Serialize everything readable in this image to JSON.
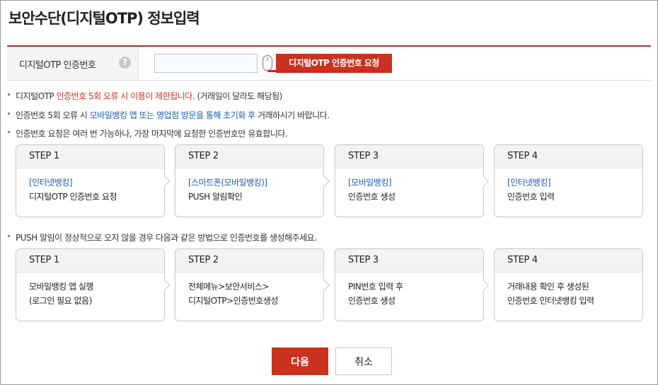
{
  "page": {
    "title": "보안수단(디지털OTP) 정보입력"
  },
  "form": {
    "label": "디지털OTP 인증번호",
    "help_icon": "question-circle-icon",
    "input_value": "",
    "mouse_icon": "mouse-icon",
    "request_button": "디지털OTP 인증번호 요청"
  },
  "notes": {
    "n1": {
      "a": "디지털OTP ",
      "b": "인증번호 5회 오류 시 이용이 제한됩니다.",
      "c": " (거래일이 달라도 해당됨)"
    },
    "n2": {
      "a": "인증번호 5회 오류 시 ",
      "b": "모바일뱅킹 앱 또는 영업점 방문을 통해 초기화 후",
      "c": " 거래하시기 바랍니다."
    },
    "n3": "인증번호 요청은 여러 번 가능하나, 가장 마지막에 요청한 인증번호만 유효합니다.",
    "n4": "PUSH 알림이 정상적으로 오지 않을 경우 다음과 같은 방법으로 인증번호를 생성해주세요."
  },
  "steps1": [
    {
      "step": "STEP 1",
      "tag": "[인터넷뱅킹]",
      "text": "디지털OTP 인증번호 요청"
    },
    {
      "step": "STEP 2",
      "tag": "[스마트폰(모바일뱅킹)]",
      "text": "PUSH 알림확인"
    },
    {
      "step": "STEP 3",
      "tag": "[모바일뱅킹]",
      "text": "인증번호 생성"
    },
    {
      "step": "STEP 4",
      "tag": "[인터넷뱅킹]",
      "text": "인증번호 입력"
    }
  ],
  "steps2": [
    {
      "step": "STEP 1",
      "l1": "모바일뱅킹 앱 실행",
      "l2": "(로그인 필요 없음)"
    },
    {
      "step": "STEP 2",
      "l1": "전체메뉴>보안서비스>",
      "l2": "디지털OTP>인증번호생성"
    },
    {
      "step": "STEP 3",
      "l1": "PIN번호 입력 후",
      "l2": "인증번호 생성"
    },
    {
      "step": "STEP 4",
      "l1": "거래내용 확인 후 생성된",
      "l2": "인증번호 인터넷뱅킹 입력"
    }
  ],
  "buttons": {
    "next": "다음",
    "cancel": "취소"
  },
  "colors": {
    "accent": "#c9321f",
    "link": "#1a5fb4"
  }
}
